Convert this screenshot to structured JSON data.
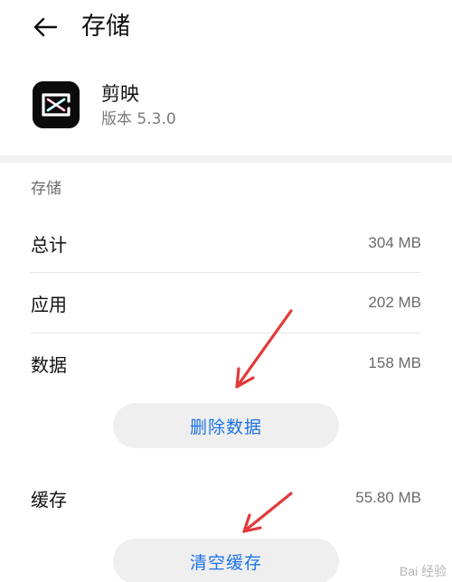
{
  "header": {
    "title": "存储"
  },
  "app": {
    "name": "剪映",
    "version": "版本 5.3.0"
  },
  "storage": {
    "section_title": "存储",
    "rows": [
      {
        "label": "总计",
        "value": "304 MB"
      },
      {
        "label": "应用",
        "value": "202 MB"
      },
      {
        "label": "数据",
        "value": "158 MB"
      }
    ],
    "delete_data_label": "删除数据",
    "cache": {
      "label": "缓存",
      "value": "55.80 MB"
    },
    "clear_cache_label": "清空缓存"
  },
  "watermark": {
    "text": "Bai 经验"
  },
  "colors": {
    "accent": "#1a73e8",
    "annotation": "#e23a3a"
  },
  "icons": {
    "back": "arrow-left-icon",
    "app": "capcut-logo-icon"
  }
}
